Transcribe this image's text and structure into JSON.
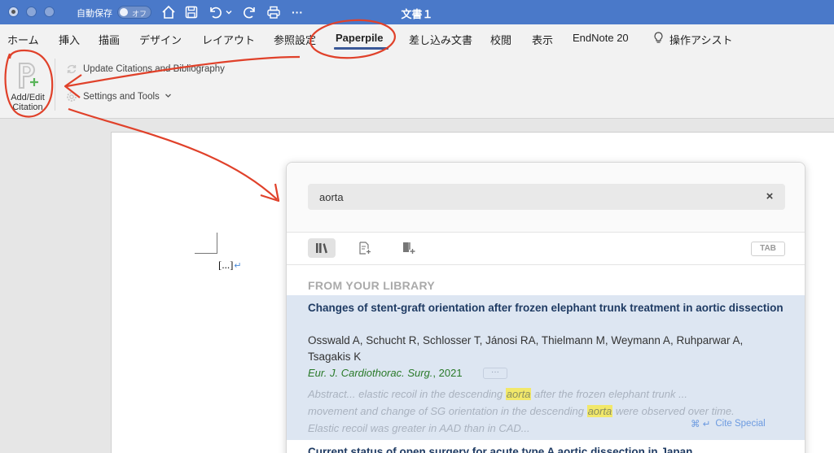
{
  "titlebar": {
    "autosave_label": "自動保存",
    "autosave_state": "オフ",
    "document_title": "文書１",
    "icons": [
      "home-icon",
      "save-icon",
      "undo-icon",
      "chevron-down-icon",
      "redo-icon",
      "print-icon",
      "more-icon"
    ],
    "more_glyph": "···"
  },
  "ribbon": {
    "tabs": [
      "ホーム",
      "挿入",
      "描画",
      "デザイン",
      "レイアウト",
      "参照設定",
      "Paperpile",
      "差し込み文書",
      "校閲",
      "表示",
      "EndNote 20",
      "操作アシスト"
    ],
    "active_tab": "Paperpile",
    "add_edit_label_1": "Add/Edit",
    "add_edit_label_2": "Citation",
    "update_label": "Update Citations and Bibliography",
    "settings_label": "Settings and Tools"
  },
  "document": {
    "placeholder": "[...]",
    "para_mark": "↵"
  },
  "panel": {
    "search_value": "aorta",
    "clear_glyph": "×",
    "tab_key": "TAB",
    "section_heading": "FROM YOUR LIBRARY",
    "result1": {
      "title": "Changes of stent-graft orientation after frozen elephant trunk treatment in aortic dissection",
      "authors": "Osswald A, Schucht R, Schlosser T, Jánosi RA, Thielmann M, Weymann A, Ruhparwar A, Tsagakis K",
      "journal": "Eur. J. Cardiothorac. Surg.",
      "year": ", 2021",
      "more": "···",
      "abstract_1": "Abstract... elastic recoil in the descending ",
      "abstract_hl1": "aorta",
      "abstract_2": " after the frozen elephant trunk ...",
      "abstract_3": "movement and change of SG orientation in the descending ",
      "abstract_hl2": "aorta",
      "abstract_4": " were observed over time.",
      "abstract_5": "Elastic recoil was greater in AAD than in CAD...",
      "cite_special_keys": "⌘ ↵",
      "cite_special_label": "Cite Special"
    },
    "result2_title": "Current status of open surgery for acute type A aortic dissection in Japan"
  },
  "colors": {
    "titlebar": "#4a79c9",
    "result_highlight": "#dde6f2",
    "title_text": "#1f3b63",
    "journal_text": "#2a7a2a",
    "annotation_red": "#e0412a"
  }
}
